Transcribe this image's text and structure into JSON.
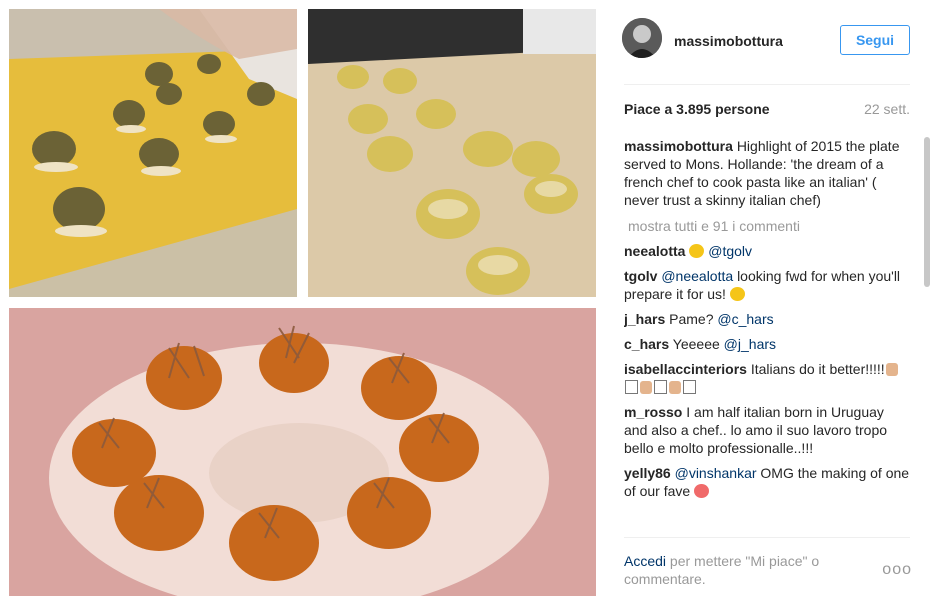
{
  "post": {
    "username": "massimobottura",
    "follow_label": "Segui",
    "likes": "Piace a 3.895 persone",
    "time": "22 sett.",
    "caption_user": "massimobottura",
    "caption_text": "Highlight of 2015 the plate served to Mons. Hollande: 'the dream of a french chef to cook pasta like an italian' ( never trust a skinny italian chef)",
    "show_all": "mostra tutti e 91 i commenti",
    "footer_link": "Accedi",
    "footer_rest": "per mettere \"Mi piace\" o commentare.",
    "more": "ooo"
  },
  "comments": [
    {
      "user": "neealotta",
      "mention": "@tgolv",
      "text": ""
    },
    {
      "user": "tgolv",
      "mention": "@neealotta",
      "text": "looking fwd for when you'll prepare it for us!"
    },
    {
      "user": "j_hars",
      "pre": "Pame?",
      "mention": "@c_hars",
      "text": ""
    },
    {
      "user": "c_hars",
      "pre": "Yeeeee",
      "mention": "@j_hars",
      "text": ""
    },
    {
      "user": "isabellaccinteriors",
      "text": "Italians do it better!!!!!"
    },
    {
      "user": "m_rosso",
      "text": "I am half italian born in Uruguay and also a chef.. lo amo il suo lavoro tropo bello e molto professionalle..!!!"
    },
    {
      "user": "yelly86",
      "mention": "@vinshankar",
      "text": "OMG the making of one of our fave"
    }
  ]
}
